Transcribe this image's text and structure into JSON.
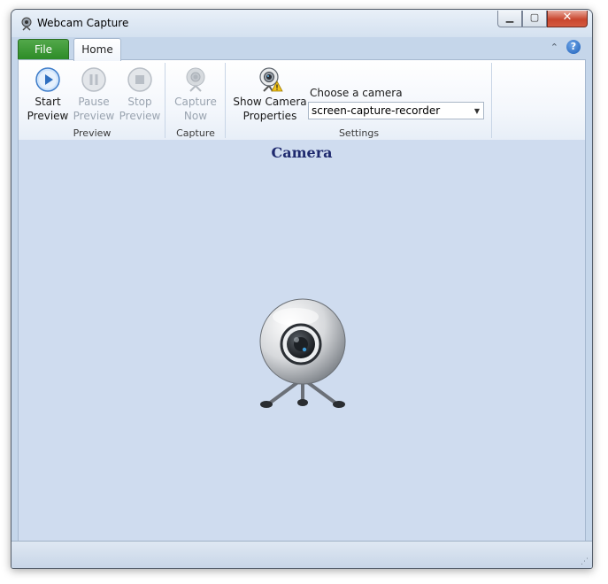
{
  "window": {
    "title": "Webcam Capture"
  },
  "window_controls": {
    "minimize": "▁",
    "maximize": "▢",
    "close": "✕"
  },
  "tabs": {
    "file": "File",
    "home": "Home"
  },
  "ribbon_extra": {
    "collapse": "⌃",
    "help": "?"
  },
  "groups": {
    "preview": {
      "label": "Preview",
      "start": {
        "line1": "Start",
        "line2": "Preview",
        "icon": "play-icon"
      },
      "pause": {
        "line1": "Pause",
        "line2": "Preview",
        "icon": "pause-icon"
      },
      "stop": {
        "line1": "Stop",
        "line2": "Preview",
        "icon": "stop-icon"
      }
    },
    "capture": {
      "label": "Capture",
      "capture_now": {
        "line1": "Capture",
        "line2": "Now",
        "icon": "webcam-icon"
      }
    },
    "settings": {
      "label": "Settings",
      "show_camera_properties": {
        "line1": "Show Camera",
        "line2": "Properties",
        "icon": "webcam-warning-icon"
      },
      "choose_label": "Choose a camera",
      "camera_value": "screen-capture-recorder"
    }
  },
  "content": {
    "title": "Camera",
    "image": "webcam-icon"
  },
  "statusbar": {
    "grip": "⋰"
  },
  "colors": {
    "file_tab": "#2b8a25",
    "accent_text": "#1f2a6e",
    "content_bg": "#cfdcef",
    "close_button": "#c9462e"
  }
}
